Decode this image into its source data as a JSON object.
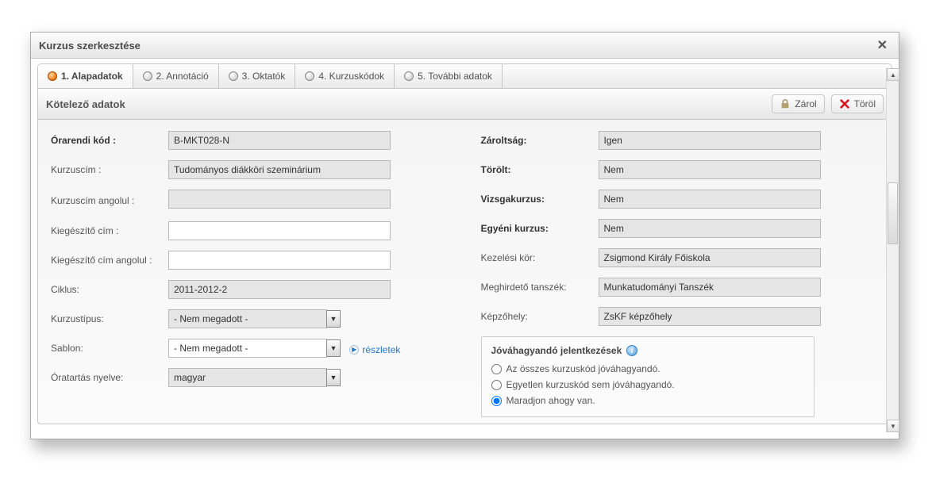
{
  "dialog": {
    "title": "Kurzus szerkesztése"
  },
  "tabs": [
    {
      "label": "1. Alapadatok"
    },
    {
      "label": "2. Annotáció"
    },
    {
      "label": "3. Oktatók"
    },
    {
      "label": "4. Kurzuskódok"
    },
    {
      "label": "5. További adatok"
    }
  ],
  "panel": {
    "header": "Kötelező adatok",
    "lock_label": "Zárol",
    "delete_label": "Töröl"
  },
  "left": {
    "orarendi_kod_label": "Órarendi kód :",
    "orarendi_kod_value": "B-MKT028-N",
    "kurzuscim_label": "Kurzuscím :",
    "kurzuscim_value": "Tudományos diákköri szeminárium",
    "kurzuscim_en_label": "Kurzuscím angolul :",
    "kurzuscim_en_value": "",
    "kieg_cim_label": "Kiegészítő cím :",
    "kieg_cim_value": "",
    "kieg_cim_en_label": "Kiegészítő cím angolul :",
    "kieg_cim_en_value": "",
    "ciklus_label": "Ciklus:",
    "ciklus_value": "2011-2012-2",
    "kurzustipus_label": "Kurzustípus:",
    "kurzustipus_value": "- Nem megadott -",
    "sablon_label": "Sablon:",
    "sablon_value": "- Nem megadott -",
    "sablon_link": "részletek",
    "nyelv_label": "Óratartás nyelve:",
    "nyelv_value": "magyar"
  },
  "right": {
    "zaroltsag_label": "Zároltság:",
    "zaroltsag_value": "Igen",
    "torolt_label": "Törölt:",
    "torolt_value": "Nem",
    "vizsgakurzus_label": "Vizsgakurzus:",
    "vizsgakurzus_value": "Nem",
    "egyeni_label": "Egyéni kurzus:",
    "egyeni_value": "Nem",
    "kezelesi_label": "Kezelési kör:",
    "kezelesi_value": "Zsigmond Király Főiskola",
    "meghirdeto_label": "Meghirdető tanszék:",
    "meghirdeto_value": "Munkatudományi Tanszék",
    "kepzohely_label": "Képzőhely:",
    "kepzohely_value": "ZsKF képzőhely"
  },
  "approval": {
    "header": "Jóváhagyandó jelentkezések",
    "opt1": "Az összes kurzuskód jóváhagyandó.",
    "opt2": "Egyetlen kurzuskód sem jóváhagyandó.",
    "opt3": "Maradjon ahogy van."
  }
}
